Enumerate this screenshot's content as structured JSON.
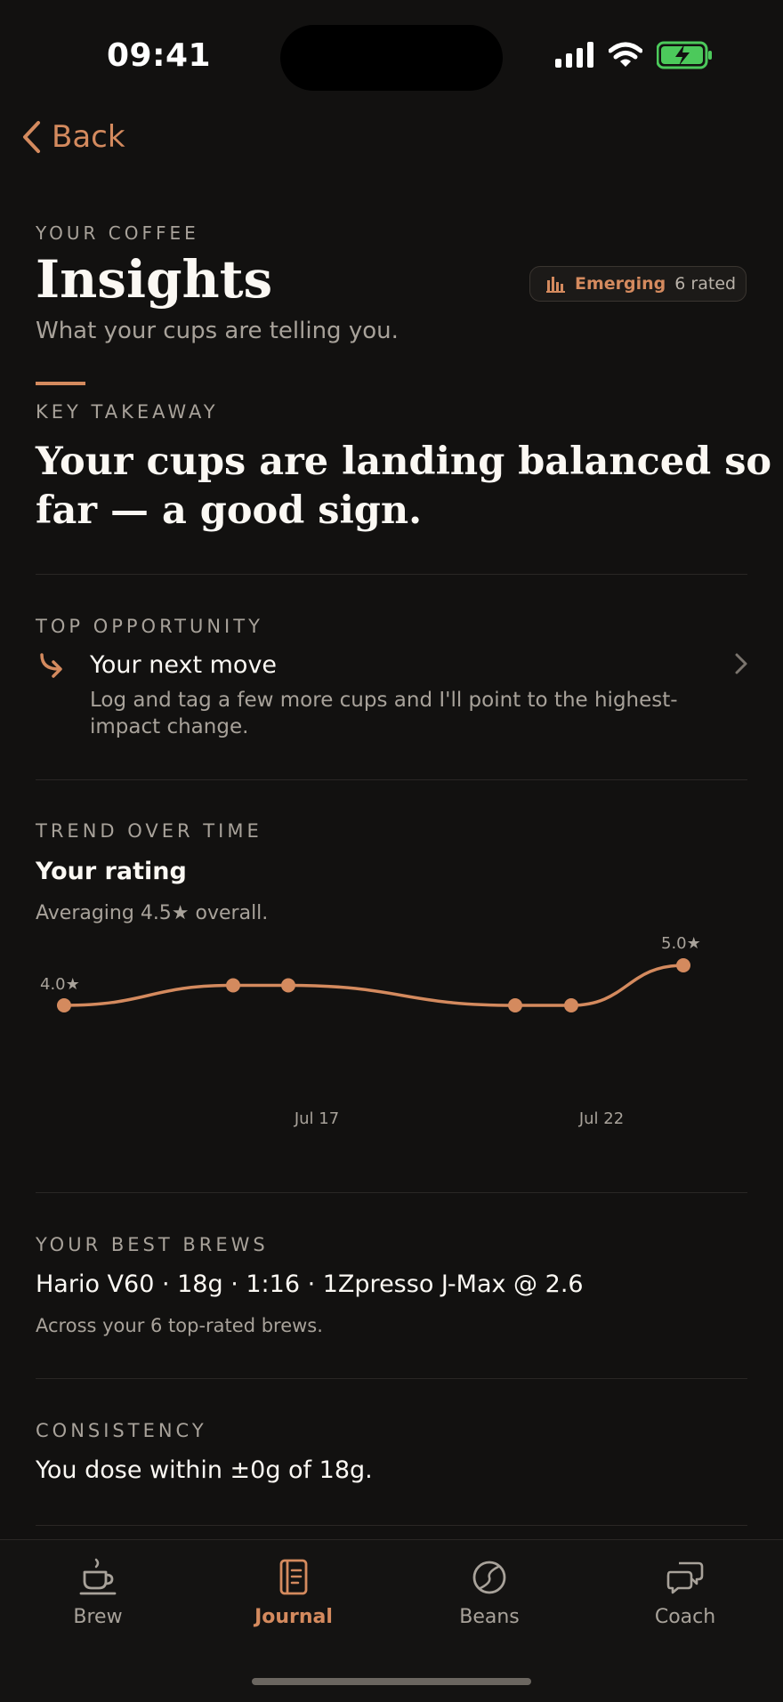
{
  "status": {
    "time": "09:41"
  },
  "nav": {
    "back_label": "Back"
  },
  "header": {
    "eyebrow": "YOUR COFFEE",
    "title": "Insights",
    "subtitle": "What your cups are telling you.",
    "badge": {
      "level": "Emerging",
      "count": "6 rated"
    }
  },
  "takeaway": {
    "eyebrow": "KEY TAKEAWAY",
    "line1": "Your cups are landing balanced so",
    "line2": "far — a good sign."
  },
  "opportunity": {
    "eyebrow": "TOP OPPORTUNITY",
    "title": "Your next move",
    "body_line1": "Log and tag a few more cups and I'll point to the highest-",
    "body_line2": "impact change."
  },
  "trend": {
    "eyebrow": "TREND OVER TIME",
    "title": "Your rating",
    "subtitle": "Averaging 4.5★ overall."
  },
  "chart_data": {
    "type": "line",
    "title": "Your rating",
    "x_tick_labels": [
      "Jul 17",
      "Jul 22"
    ],
    "points": [
      4.0,
      4.5,
      4.5,
      4.0,
      4.0,
      5.0
    ],
    "point_labels": [
      "4.0★",
      "5.0★"
    ],
    "ylim": [
      4.0,
      5.0
    ],
    "color": "#d48a5e"
  },
  "best": {
    "eyebrow": "YOUR BEST BREWS",
    "recipe": "Hario V60 · 18g · 1:16 · 1Zpresso J-Max @ 2.6",
    "note": "Across your 6 top-rated brews."
  },
  "consistency": {
    "eyebrow": "CONSISTENCY",
    "text": "You dose within ±0g of 18g."
  },
  "tabs": [
    {
      "label": "Brew",
      "icon": "cup-icon"
    },
    {
      "label": "Journal",
      "icon": "journal-icon"
    },
    {
      "label": "Beans",
      "icon": "bean-icon"
    },
    {
      "label": "Coach",
      "icon": "chat-icon"
    }
  ],
  "colors": {
    "accent": "#d48a5e",
    "background": "#121110"
  }
}
